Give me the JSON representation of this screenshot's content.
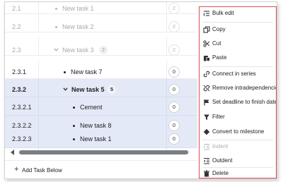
{
  "rows": [
    {
      "wbs": "2.1",
      "name": "New task 1",
      "circle": "2",
      "faded": true
    },
    {
      "wbs": "2.2",
      "name": "New task 2",
      "circle": "2",
      "faded": true
    },
    {
      "wbs": "2.3",
      "name": "New task 3",
      "count": "2",
      "circle": "2",
      "faded": true
    },
    {
      "wbs": "2.3.1",
      "name": "New task 7",
      "circle": "0"
    },
    {
      "wbs": "2.3.2",
      "name": "New task 5",
      "count": "5",
      "circle": "0"
    },
    {
      "wbs": "2.3.2.1",
      "name": "Cement",
      "circle": "0"
    },
    {
      "wbs": "2.3.2.2",
      "name": "New task 8",
      "circle": "0"
    },
    {
      "wbs": "2.3.2.3",
      "name": "New task 1",
      "circle": "0"
    }
  ],
  "add_task_label": "Add Task Below",
  "menu": {
    "bulk_edit": "Bulk edit",
    "copy": "Copy",
    "cut": "Cut",
    "paste": "Paste",
    "connect": "Connect in series",
    "remove_intra": "Remove intradependencies",
    "set_deadline": "Set deadline to finish date",
    "filter": "Filter",
    "convert": "Convert to milestone",
    "indent": "Indent",
    "outdent": "Outdent",
    "delete": "Delete"
  },
  "colors": {
    "selection_bg": "#e4e9f7",
    "menu_border": "#e04a52",
    "disabled_text": "#a8adb2"
  }
}
